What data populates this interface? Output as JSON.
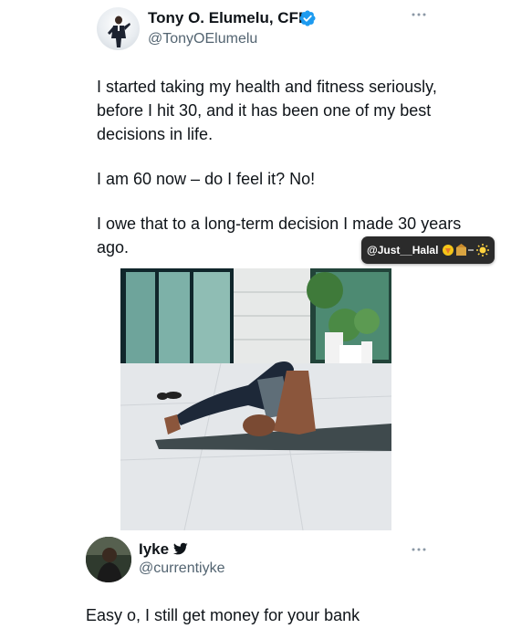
{
  "tweet": {
    "author_name": "Tony O. Elumelu, CFR",
    "handle": "@TonyOElumelu",
    "verified_icon": "verified-badge-icon",
    "more_icon": "more-options-icon",
    "paragraphs": [
      "I started taking my health and fitness seriously, before I hit 30, and it has been one of my best decisions in life.",
      "I am 60 now – do I feel it? No!",
      "I owe that to a long-term decision I made 30 years ago."
    ],
    "image_icon": "yoga-plow-pose-photo"
  },
  "watermark": {
    "text": "@Just__Halal",
    "emoji_icon": "emoji-strip-icon"
  },
  "reply": {
    "author_name": "Iyke",
    "handle": "@currentiyke",
    "text": "Easy o, I still get money for your bank",
    "bird_icon": "twitter-bird-icon",
    "more_icon": "more-options-icon"
  },
  "colors": {
    "text_primary": "#0f1419",
    "text_secondary": "#536471",
    "verified_blue": "#1d9bf0",
    "badge_bg": "#2b2b2b"
  }
}
